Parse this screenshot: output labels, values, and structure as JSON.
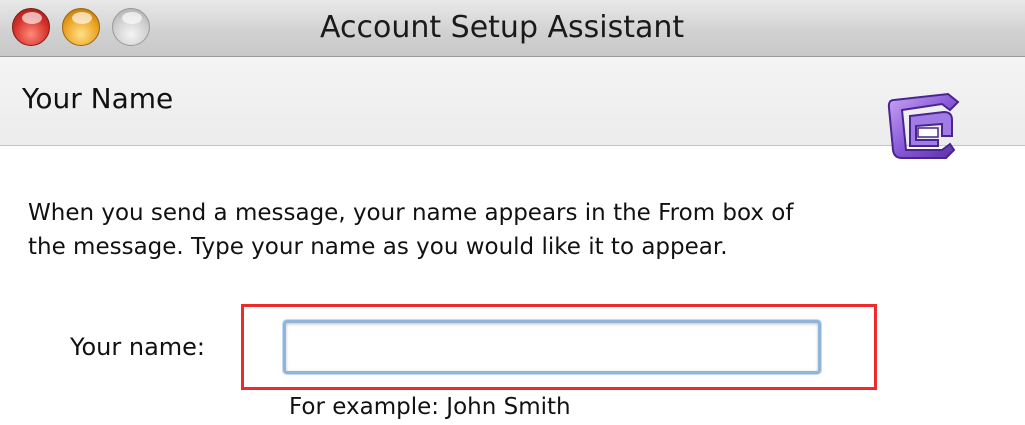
{
  "window": {
    "title": "Account Setup Assistant"
  },
  "header": {
    "title": "Your Name",
    "app_icon": "entourage-app-icon"
  },
  "description": {
    "line1": "When you send a message, your name appears in the From box of",
    "line2": "the message. Type your name as you would like it to appear."
  },
  "form": {
    "name_label": "Your name:",
    "name_value": "",
    "name_placeholder": "",
    "example_hint": "For example: John Smith"
  },
  "colors": {
    "highlight": "#ee2a2a",
    "input_focus_ring": "#8fb5db",
    "app_icon_purple": "#7b4fc9"
  }
}
